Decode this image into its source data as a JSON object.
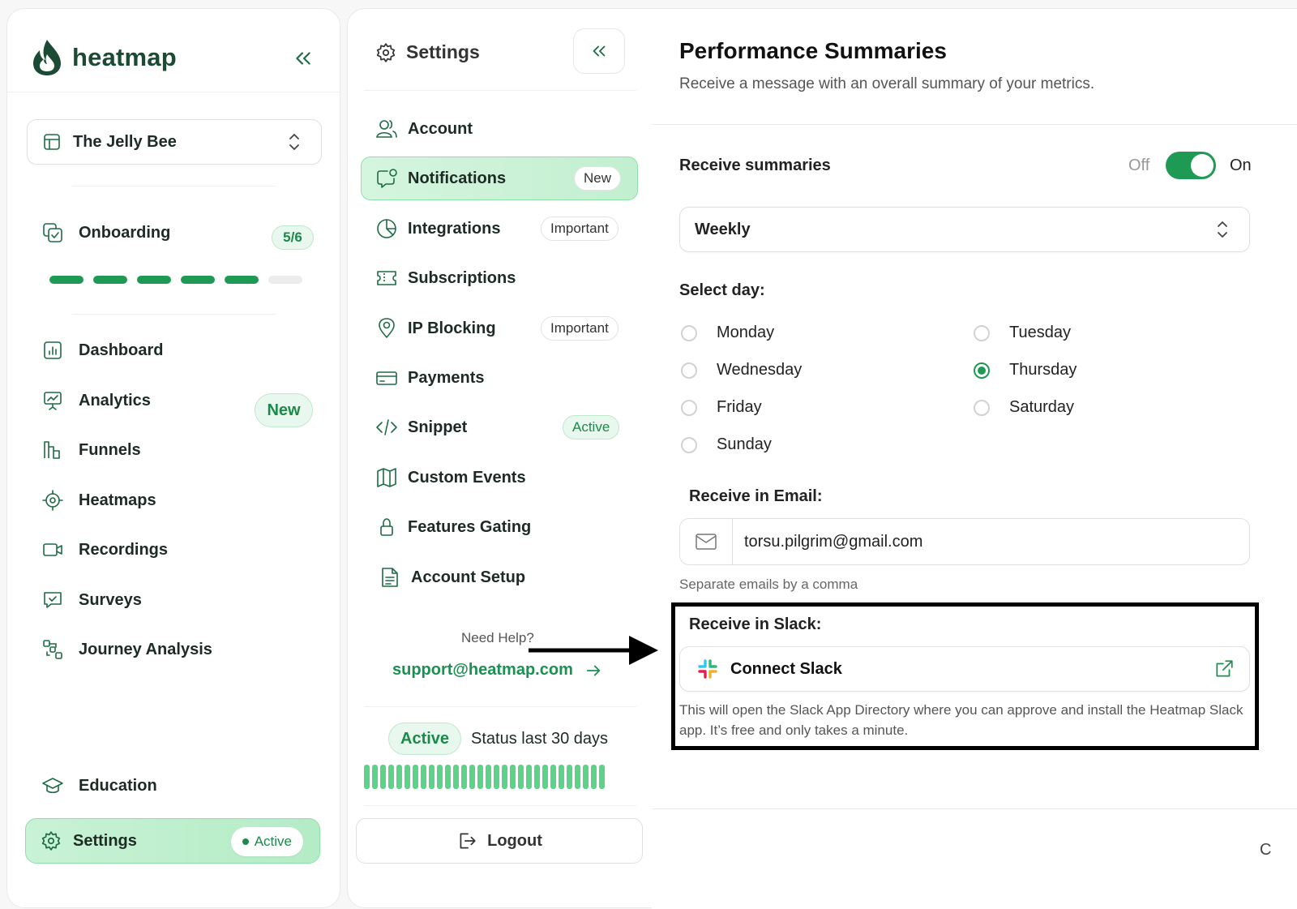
{
  "brand": {
    "name": "heatmap"
  },
  "workspace": {
    "name": "The Jelly Bee"
  },
  "onboarding": {
    "label": "Onboarding",
    "progress_text": "5/6",
    "completed_steps": 5,
    "total_steps": 6
  },
  "sidebar": {
    "items": [
      {
        "label": "Dashboard",
        "icon": "dashboard-icon"
      },
      {
        "label": "Analytics",
        "icon": "analytics-icon",
        "badge": "New"
      },
      {
        "label": "Funnels",
        "icon": "funnels-icon"
      },
      {
        "label": "Heatmaps",
        "icon": "heatmaps-icon"
      },
      {
        "label": "Recordings",
        "icon": "recordings-icon"
      },
      {
        "label": "Surveys",
        "icon": "surveys-icon"
      },
      {
        "label": "Journey Analysis",
        "icon": "journey-icon"
      }
    ],
    "education": "Education",
    "settings": {
      "label": "Settings",
      "badge": "Active"
    }
  },
  "settings_nav": {
    "title": "Settings",
    "items": [
      {
        "label": "Account",
        "icon": "user-icon"
      },
      {
        "label": "Notifications",
        "icon": "chat-bell-icon",
        "badge": "New",
        "active": true
      },
      {
        "label": "Integrations",
        "icon": "pie-chart-icon",
        "badge": "Important"
      },
      {
        "label": "Subscriptions",
        "icon": "ticket-icon"
      },
      {
        "label": "IP Blocking",
        "icon": "location-pin-icon",
        "badge": "Important"
      },
      {
        "label": "Payments",
        "icon": "credit-card-icon"
      },
      {
        "label": "Snippet",
        "icon": "code-icon",
        "badge": "Active"
      },
      {
        "label": "Custom Events",
        "icon": "map-icon"
      },
      {
        "label": "Features Gating",
        "icon": "lock-icon"
      },
      {
        "label": "Account Setup",
        "icon": "document-icon"
      }
    ],
    "help_question": "Need Help?",
    "help_email": "support@heatmap.com",
    "status_badge": "Active",
    "status_text": "Status last 30 days",
    "logout": "Logout"
  },
  "main": {
    "title": "Performance Summaries",
    "subtitle": "Receive a message with an overall summary of your metrics.",
    "receive_label": "Receive summaries",
    "toggle_off": "Off",
    "toggle_on": "On",
    "toggle_state": true,
    "frequency": "Weekly",
    "select_day_label": "Select day:",
    "days": [
      {
        "label": "Monday",
        "selected": false
      },
      {
        "label": "Tuesday",
        "selected": false
      },
      {
        "label": "Wednesday",
        "selected": false
      },
      {
        "label": "Thursday",
        "selected": true
      },
      {
        "label": "Friday",
        "selected": false
      },
      {
        "label": "Saturday",
        "selected": false
      },
      {
        "label": "Sunday",
        "selected": false
      }
    ],
    "email_label": "Receive in Email:",
    "email_value": "torsu.pilgrim@gmail.com",
    "email_hint": "Separate emails by a comma",
    "slack_label": "Receive in Slack:",
    "slack_button": "Connect Slack",
    "slack_description": "This will open the Slack App Directory where you can approve and install the Heatmap Slack app. It’s free and only takes a minute.",
    "footer_fragment": "C"
  },
  "colors": {
    "accent": "#1f9a55",
    "brand_dark": "#1b4a35",
    "highlight_border": "#000000"
  }
}
